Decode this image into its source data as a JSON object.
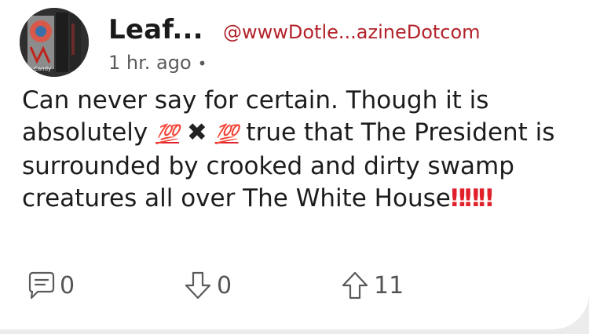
{
  "post": {
    "author_name": "Leaf...",
    "handle": "@wwwDotle...azineDotcom",
    "time_ago": "1 hr. ago",
    "meta_separator": "•",
    "avatar_text": "Candy",
    "content_part1": "Can never say for certain. Though it is absolutely ",
    "emoji_100_a": "💯",
    "emoji_x": "✖",
    "emoji_100_b": "💯",
    "content_part2": " true that The President is surrounded by crooked and dirty swamp creatures all over The White House",
    "emoji_bangs": "‼‼‼"
  },
  "actions": {
    "comment_count": "0",
    "downvote_count": "0",
    "upvote_count": "11"
  },
  "colors": {
    "handle": "#b3232b",
    "text": "#1c1c1c",
    "icon": "#5a5a5a"
  }
}
